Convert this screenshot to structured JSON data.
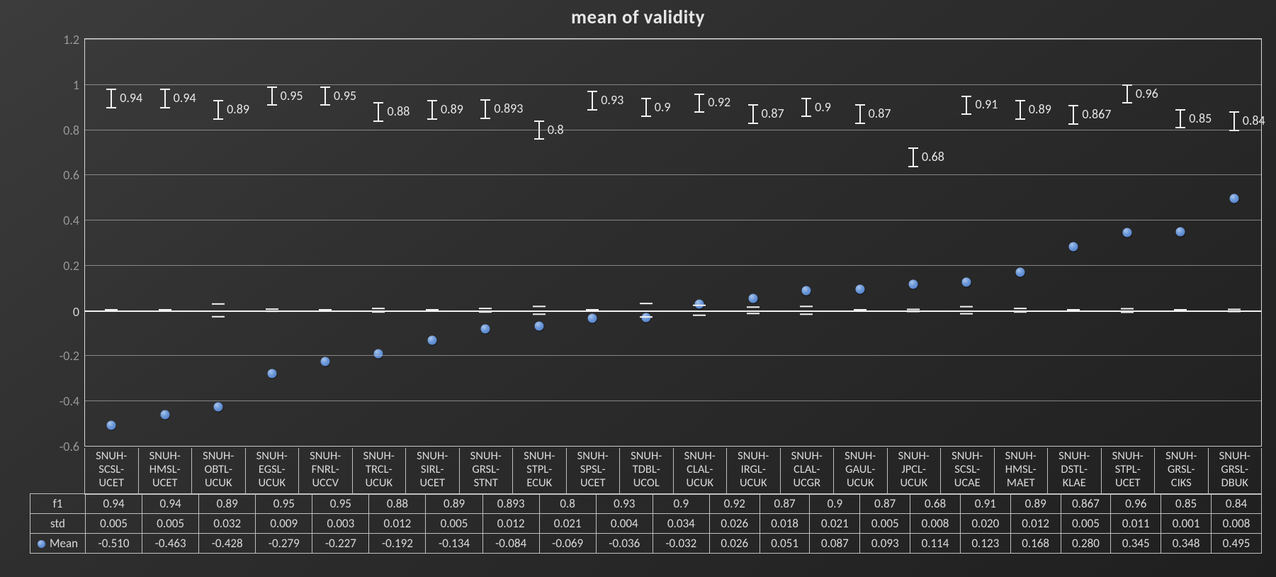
{
  "chart_data": {
    "type": "scatter+errorbar+table",
    "title": "mean of validity",
    "ylim": [
      -0.6,
      1.2
    ],
    "yticks": [
      -0.6,
      -0.4,
      -0.2,
      0,
      0.2,
      0.4,
      0.6,
      0.8,
      1,
      1.2
    ],
    "legend": {
      "f1": "f1",
      "std": "std",
      "mean": "Mean"
    },
    "categories": [
      "SNUH-SCSL-UCET",
      "SNUH-HMSL-UCET",
      "SNUH-OBTL-UCUK",
      "SNUH-EGSL-UCUK",
      "SNUH-FNRL-UCCV",
      "SNUH-TRCL-UCUK",
      "SNUH-SIRL-UCET",
      "SNUH-GRSL-STNT",
      "SNUH-STPL-ECUK",
      "SNUH-SPSL-UCET",
      "SNUH-TDBL-UCOL",
      "SNUH-CLAL-UCUK",
      "SNUH-IRGL-UCUK",
      "SNUH-CLAL-UCGR",
      "SNUH-GAUL-UCUK",
      "SNUH-JPCL-UCUK",
      "SNUH-SCSL-UCAE",
      "SNUH-HMSL-MAET",
      "SNUH-DSTL-KLAE",
      "SNUH-STPL-UCET",
      "SNUH-GRSL-CIKS",
      "SNUH-GRSL-DBUK"
    ],
    "series": [
      {
        "name": "f1",
        "values": [
          0.94,
          0.94,
          0.89,
          0.95,
          0.95,
          0.88,
          0.89,
          0.893,
          0.8,
          0.93,
          0.9,
          0.92,
          0.87,
          0.9,
          0.87,
          0.68,
          0.91,
          0.89,
          0.867,
          0.96,
          0.85,
          0.84
        ]
      },
      {
        "name": "std",
        "values": [
          0.005,
          0.005,
          0.032,
          0.009,
          0.003,
          0.012,
          0.005,
          0.012,
          0.021,
          0.004,
          0.034,
          0.026,
          0.018,
          0.021,
          0.005,
          0.008,
          0.02,
          0.012,
          0.005,
          0.011,
          0.001,
          0.008
        ]
      },
      {
        "name": "Mean",
        "values": [
          -0.51,
          -0.463,
          -0.428,
          -0.279,
          -0.227,
          -0.192,
          -0.134,
          -0.084,
          -0.069,
          -0.036,
          -0.032,
          0.026,
          0.051,
          0.087,
          0.093,
          0.114,
          0.123,
          0.168,
          0.28,
          0.345,
          0.348,
          0.495
        ]
      }
    ],
    "f1_display": [
      "0.94",
      "0.94",
      "0.89",
      "0.95",
      "0.95",
      "0.88",
      "0.89",
      "0.893",
      "0.8",
      "0.93",
      "0.9",
      "0.92",
      "0.87",
      "0.9",
      "0.87",
      "0.68",
      "0.91",
      "0.89",
      "0.867",
      "0.96",
      "0.85",
      "0.84"
    ],
    "std_display": [
      "0.005",
      "0.005",
      "0.032",
      "0.009",
      "0.003",
      "0.012",
      "0.005",
      "0.012",
      "0.021",
      "0.004",
      "0.034",
      "0.026",
      "0.018",
      "0.021",
      "0.005",
      "0.008",
      "0.020",
      "0.012",
      "0.005",
      "0.011",
      "0.001",
      "0.008"
    ],
    "mean_display": [
      "-0.510",
      "-0.463",
      "-0.428",
      "-0.279",
      "-0.227",
      "-0.192",
      "-0.134",
      "-0.084",
      "-0.069",
      "-0.036",
      "-0.032",
      "0.026",
      "0.051",
      "0.087",
      "0.093",
      "0.114",
      "0.123",
      "0.168",
      "0.280",
      "0.345",
      "0.348",
      "0.495"
    ]
  }
}
